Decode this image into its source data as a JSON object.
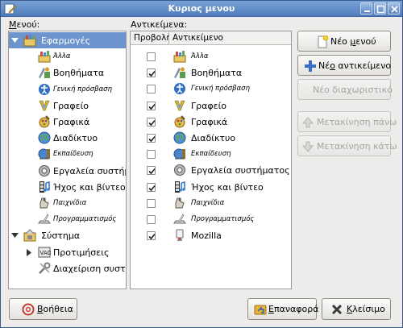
{
  "window": {
    "title": "Κυριος μενου",
    "controls": [
      "minimize",
      "maximize",
      "close"
    ]
  },
  "left_panel": {
    "label": "Μενού:",
    "label_mnemonic": "Μ",
    "tree": [
      {
        "label": "Εφαρμογές",
        "level": 0,
        "expanded": true,
        "selected": true,
        "icon": "applications-icon",
        "style": "normal"
      },
      {
        "label": "Άλλα",
        "level": 1,
        "icon": "other-icon",
        "style": "small"
      },
      {
        "label": "Βοηθήματα",
        "level": 1,
        "icon": "accessories-icon",
        "style": "normal"
      },
      {
        "label": "Γενική πρόσβαση",
        "level": 1,
        "icon": "accessibility-icon",
        "style": "small"
      },
      {
        "label": "Γραφείο",
        "level": 1,
        "icon": "office-icon",
        "style": "normal"
      },
      {
        "label": "Γραφικά",
        "level": 1,
        "icon": "graphics-icon",
        "style": "normal"
      },
      {
        "label": "Διαδίκτυο",
        "level": 1,
        "icon": "internet-icon",
        "style": "normal"
      },
      {
        "label": "Εκπαίδευση",
        "level": 1,
        "icon": "education-icon",
        "style": "small"
      },
      {
        "label": "Εργαλεία συστήματος",
        "level": 1,
        "icon": "system-tools-icon",
        "style": "normal"
      },
      {
        "label": "Ήχος και βίντεο",
        "level": 1,
        "icon": "sound-video-icon",
        "style": "normal"
      },
      {
        "label": "Παιχνίδια",
        "level": 1,
        "icon": "games-icon",
        "style": "small"
      },
      {
        "label": "Προγραμματισμός",
        "level": 1,
        "icon": "programming-icon",
        "style": "small"
      },
      {
        "label": "Σύστημα",
        "level": 0,
        "expanded": true,
        "icon": "system-icon",
        "style": "normal"
      },
      {
        "label": "Προτιμήσεις",
        "level": 1,
        "expandable": true,
        "icon": "preferences-icon",
        "style": "normal"
      },
      {
        "label": "Διαχείριση συστήματος",
        "level": 1,
        "icon": "administration-icon",
        "style": "normal"
      }
    ]
  },
  "right_panel": {
    "label": "Αντικείμενα:",
    "label_mnemonic": "τ",
    "columns": [
      "Προβολή",
      "Αντικείμενο"
    ],
    "items": [
      {
        "checked": false,
        "label": "Άλλα",
        "icon": "other-icon",
        "style": "small"
      },
      {
        "checked": true,
        "label": "Βοηθήματα",
        "icon": "accessories-icon",
        "style": "normal"
      },
      {
        "checked": false,
        "label": "Γενική πρόσβαση",
        "icon": "accessibility-icon",
        "style": "small"
      },
      {
        "checked": true,
        "label": "Γραφείο",
        "icon": "office-icon",
        "style": "normal"
      },
      {
        "checked": true,
        "label": "Γραφικά",
        "icon": "graphics-icon",
        "style": "normal"
      },
      {
        "checked": true,
        "label": "Διαδίκτυο",
        "icon": "internet-icon",
        "style": "normal"
      },
      {
        "checked": false,
        "label": "Εκπαίδευση",
        "icon": "education-icon",
        "style": "small"
      },
      {
        "checked": true,
        "label": "Εργαλεία συστήματος",
        "icon": "system-tools-icon",
        "style": "normal"
      },
      {
        "checked": true,
        "label": "Ήχος και βίντεο",
        "icon": "sound-video-icon",
        "style": "normal"
      },
      {
        "checked": false,
        "label": "Παιχνίδια",
        "icon": "games-icon",
        "style": "small"
      },
      {
        "checked": false,
        "label": "Προγραμματισμός",
        "icon": "programming-icon",
        "style": "small"
      },
      {
        "checked": true,
        "label": "Mozilla",
        "icon": "mozilla-icon",
        "style": "normal"
      }
    ]
  },
  "actions": {
    "new_menu": {
      "prefix": "Νέο ",
      "mnemonic": "μ",
      "suffix": "ενού",
      "icon": "new-menu-icon",
      "enabled": true
    },
    "new_item": {
      "prefix": "Νέ",
      "mnemonic": "ο",
      "suffix": " αντικείμενο",
      "icon": "new-item-icon",
      "enabled": true
    },
    "new_separator": {
      "label": "Νέο διαχωριστικό",
      "enabled": false
    },
    "move_up": {
      "label": "Μετακίνηση πάνω",
      "icon": "move-up-icon",
      "enabled": false
    },
    "move_down": {
      "label": "Μετακίνηση κάτω",
      "icon": "move-down-icon",
      "enabled": false
    }
  },
  "footer": {
    "help": {
      "label": "Βοήθεια",
      "mnemonic": "Β",
      "icon": "help-icon"
    },
    "revert": {
      "label": "Επαναφορά",
      "mnemonic": "Ε",
      "icon": "revert-icon"
    },
    "close": {
      "label": "Κλείσιμο",
      "mnemonic": "Κ",
      "icon": "close-icon"
    }
  },
  "colors": {
    "titlebar": "#5b86c6",
    "selection": "#6d94cd",
    "window_bg": "#edeceb"
  }
}
